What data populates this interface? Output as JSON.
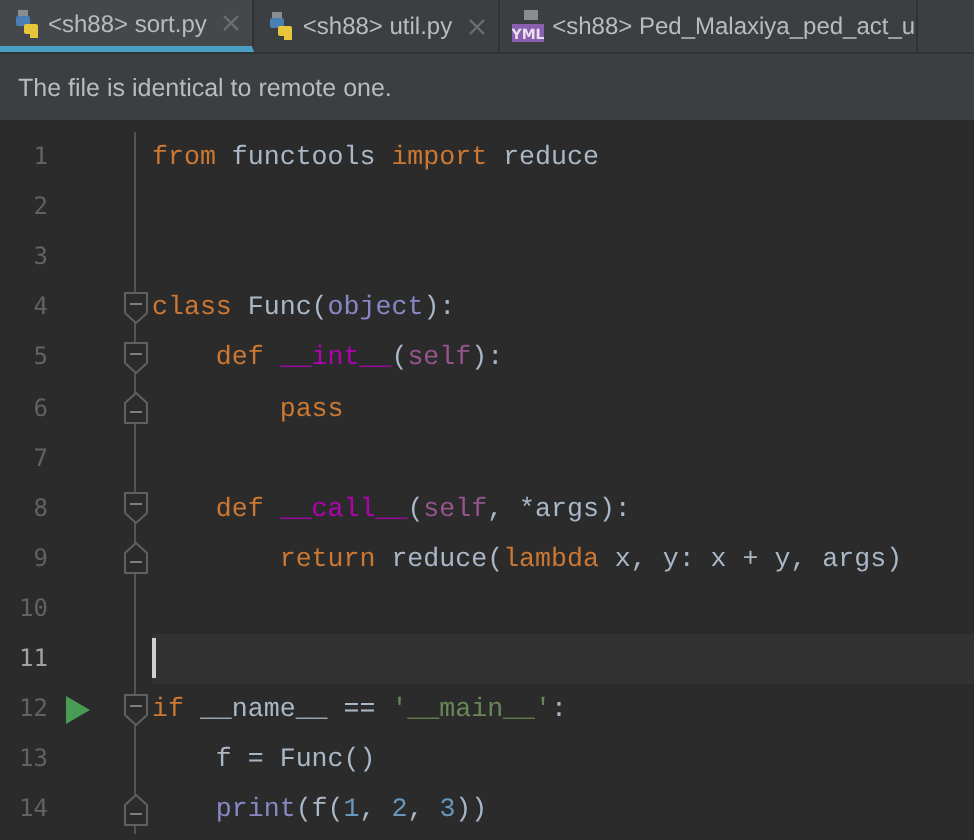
{
  "tabs": [
    {
      "kind": "python",
      "label": "<sh88> sort.py",
      "closable": true,
      "selected": true
    },
    {
      "kind": "python",
      "label": "<sh88> util.py",
      "closable": true,
      "selected": false
    },
    {
      "kind": "yaml",
      "badge": "YML",
      "label": "<sh88> Ped_Malaxiya_ped_act_u",
      "closable": false,
      "selected": false
    }
  ],
  "banner": {
    "message": "The file is identical to remote one."
  },
  "editor": {
    "lines": [
      {
        "number": "1",
        "run": false,
        "kind": "plain",
        "current": false,
        "tokens": [
          {
            "kind": "kw",
            "text": "from"
          },
          {
            "kind": "plain",
            "text": " functools "
          },
          {
            "kind": "kw",
            "text": "import"
          },
          {
            "kind": "plain",
            "text": " reduce"
          }
        ]
      },
      {
        "number": "2",
        "run": false,
        "kind": "plain",
        "current": false
      },
      {
        "number": "3",
        "run": false,
        "kind": "plain",
        "current": false
      },
      {
        "number": "4",
        "run": false,
        "kind": "opener",
        "current": false,
        "tokens": [
          {
            "kind": "kw",
            "text": "class"
          },
          {
            "kind": "plain",
            "text": " Func("
          },
          {
            "kind": "builtin",
            "text": "object"
          },
          {
            "kind": "plain",
            "text": "):"
          }
        ]
      },
      {
        "number": "5",
        "run": false,
        "kind": "opener",
        "current": false,
        "tokens": [
          {
            "kind": "kw",
            "text": "    def "
          },
          {
            "kind": "magic",
            "text": "__int__"
          },
          {
            "kind": "plain",
            "text": "("
          },
          {
            "kind": "self",
            "text": "self"
          },
          {
            "kind": "plain",
            "text": "):"
          }
        ]
      },
      {
        "number": "6",
        "run": false,
        "kind": "closer",
        "current": false,
        "tokens": [
          {
            "kind": "kw",
            "text": "        pass"
          }
        ]
      },
      {
        "number": "7",
        "run": false,
        "kind": "plain",
        "current": false
      },
      {
        "number": "8",
        "run": false,
        "kind": "opener",
        "current": false,
        "tokens": [
          {
            "kind": "kw",
            "text": "    def "
          },
          {
            "kind": "magic",
            "text": "__call__"
          },
          {
            "kind": "plain",
            "text": "("
          },
          {
            "kind": "self",
            "text": "self"
          },
          {
            "kind": "plain",
            "text": ", *args):"
          }
        ]
      },
      {
        "number": "9",
        "run": false,
        "kind": "closer",
        "current": false,
        "tokens": [
          {
            "kind": "kw",
            "text": "        return"
          },
          {
            "kind": "plain",
            "text": " reduce("
          },
          {
            "kind": "kw",
            "text": "lambda"
          },
          {
            "kind": "plain",
            "text": " x, y: x + y, args)"
          }
        ]
      },
      {
        "number": "10",
        "run": false,
        "kind": "plain",
        "current": false
      },
      {
        "number": "11",
        "run": false,
        "kind": "plain",
        "current": true
      },
      {
        "number": "12",
        "run": true,
        "kind": "opener",
        "current": false,
        "tokens": [
          {
            "kind": "kw",
            "text": "if"
          },
          {
            "kind": "plain",
            "text": " __name__ == "
          },
          {
            "kind": "str",
            "text": "'__main__'"
          },
          {
            "kind": "plain",
            "text": ":"
          }
        ]
      },
      {
        "number": "13",
        "run": false,
        "kind": "plain",
        "current": false,
        "tokens": [
          {
            "kind": "plain",
            "text": "    f = Func()"
          }
        ]
      },
      {
        "number": "14",
        "run": false,
        "kind": "closer",
        "current": false,
        "tokens": [
          {
            "kind": "builtin",
            "text": "    print"
          },
          {
            "kind": "plain",
            "text": "(f("
          },
          {
            "kind": "num",
            "text": "1"
          },
          {
            "kind": "plain",
            "text": ", "
          },
          {
            "kind": "num",
            "text": "2"
          },
          {
            "kind": "plain",
            "text": ", "
          },
          {
            "kind": "num",
            "text": "3"
          },
          {
            "kind": "plain",
            "text": "))"
          }
        ]
      }
    ]
  }
}
